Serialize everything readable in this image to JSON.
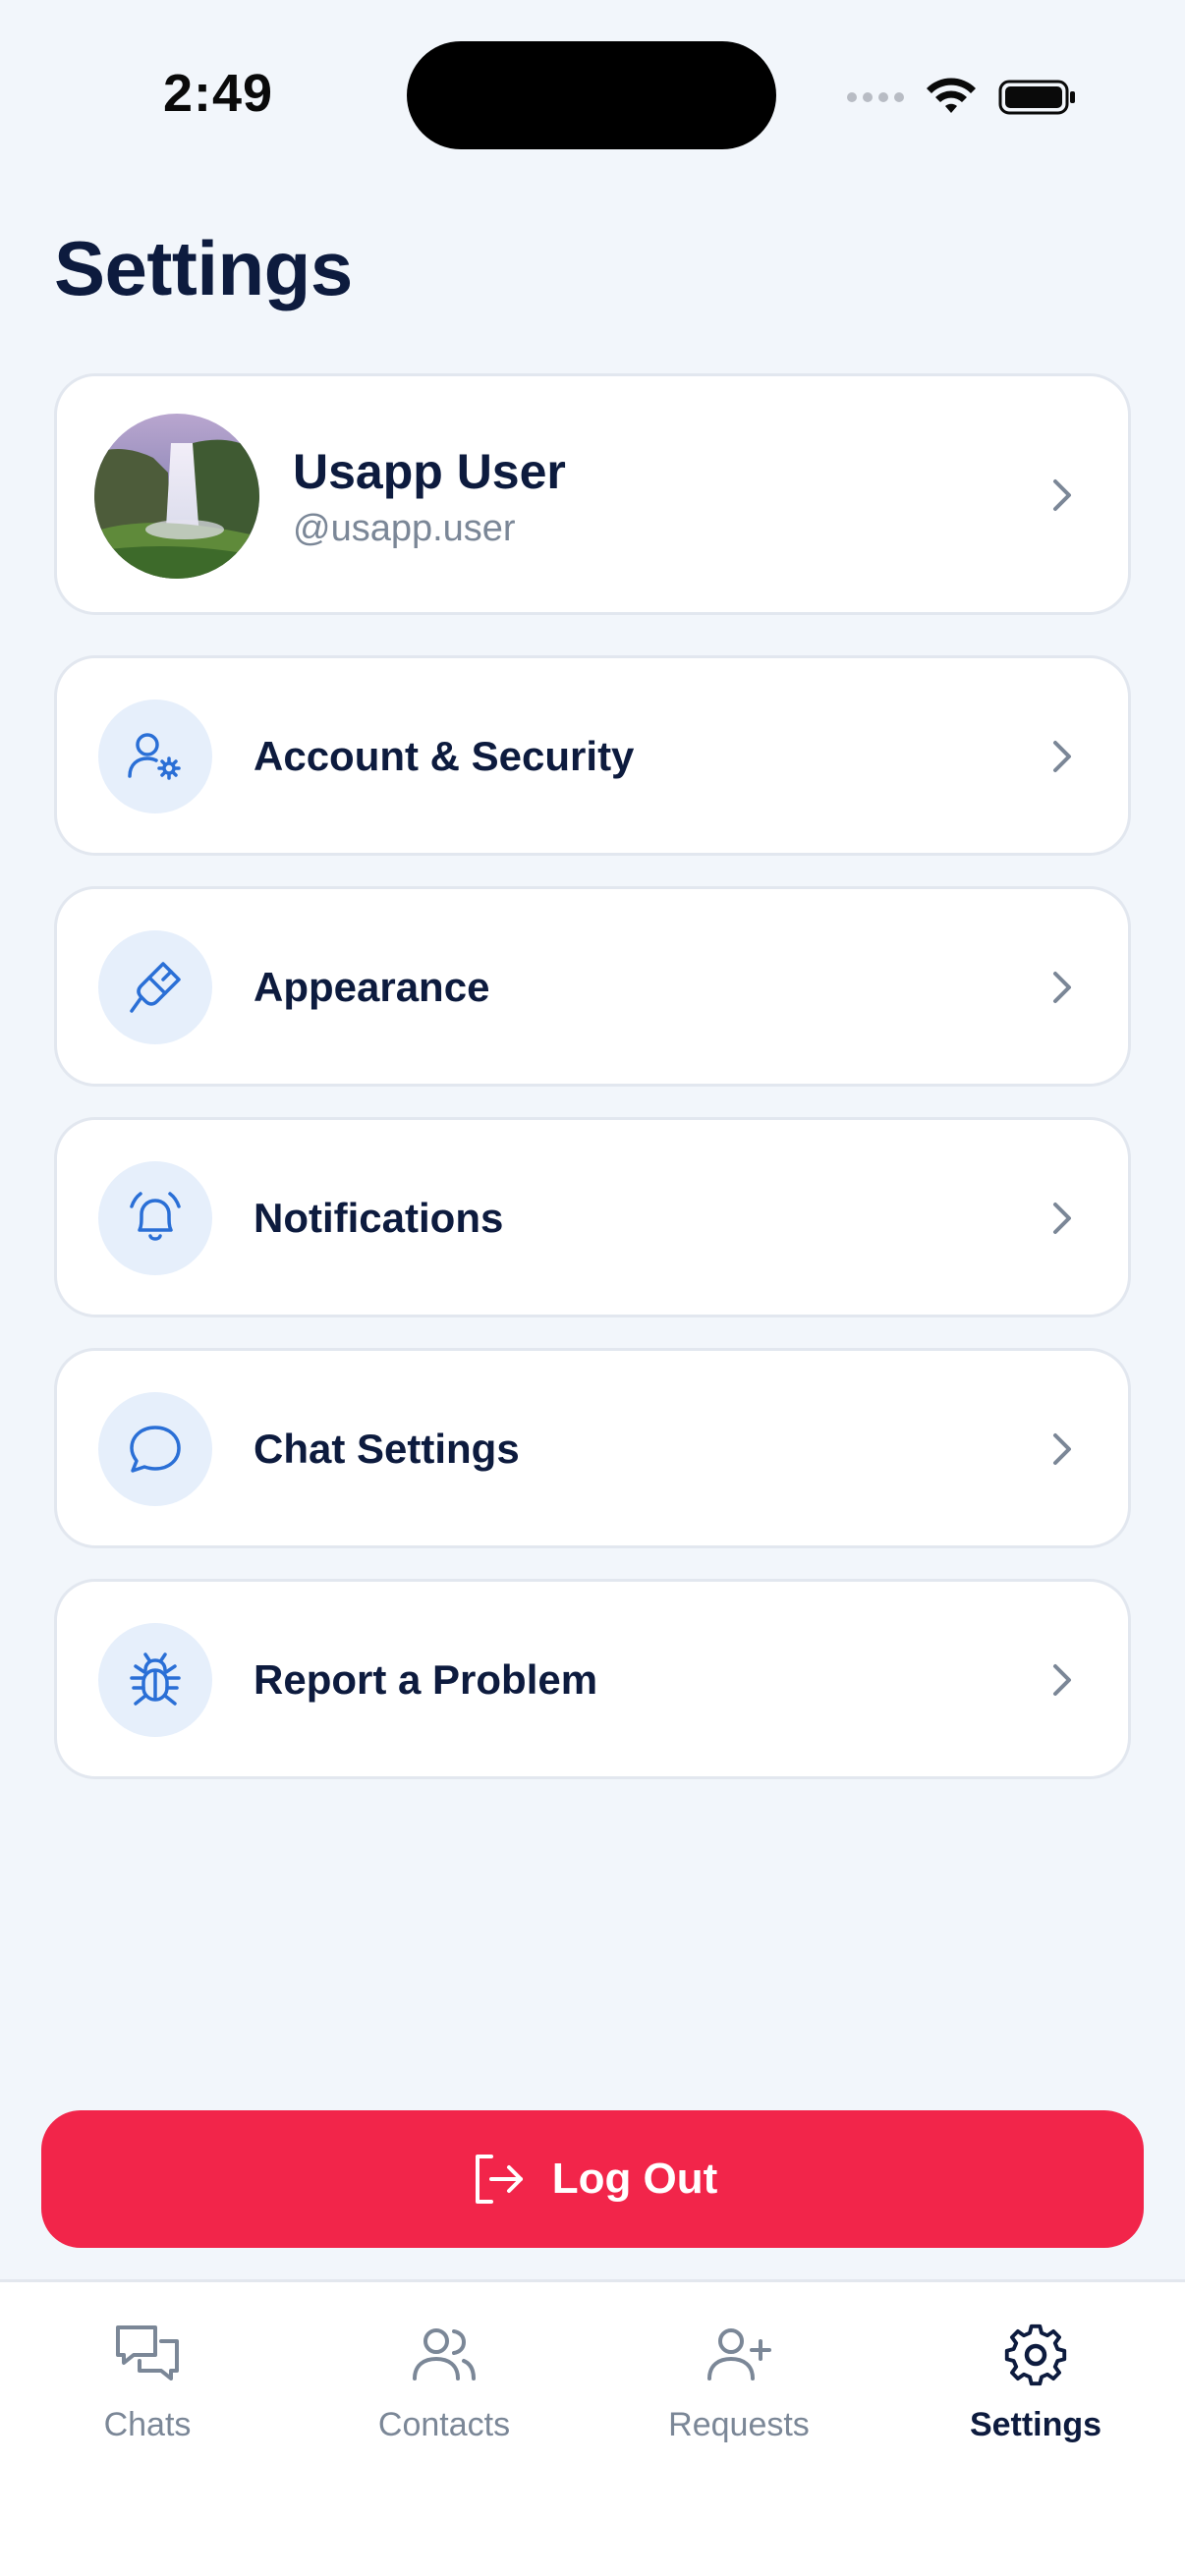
{
  "status_bar": {
    "time": "2:49"
  },
  "page_title": "Settings",
  "profile": {
    "name": "Usapp User",
    "handle": "@usapp.user"
  },
  "menu": [
    {
      "label": "Account & Security",
      "icon": "user-gear-icon"
    },
    {
      "label": "Appearance",
      "icon": "paintbrush-icon"
    },
    {
      "label": "Notifications",
      "icon": "bell-icon"
    },
    {
      "label": "Chat Settings",
      "icon": "chat-bubble-icon"
    },
    {
      "label": "Report a Problem",
      "icon": "bug-icon"
    }
  ],
  "logout_label": "Log Out",
  "tabs": [
    {
      "label": "Chats",
      "icon": "chats-icon",
      "active": false
    },
    {
      "label": "Contacts",
      "icon": "contacts-icon",
      "active": false
    },
    {
      "label": "Requests",
      "icon": "add-user-icon",
      "active": false
    },
    {
      "label": "Settings",
      "icon": "gear-icon",
      "active": true
    }
  ],
  "colors": {
    "accent": "#2a6fd6",
    "icon_bg": "#e6effb",
    "logout": "#f2254a",
    "text_primary": "#0d1b3e",
    "text_muted": "#7b8797",
    "background": "#f2f6fb"
  }
}
